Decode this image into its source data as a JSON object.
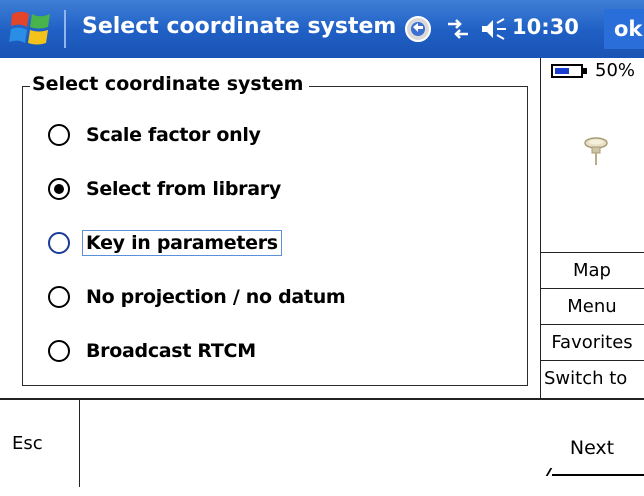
{
  "titlebar": {
    "title": "Select coordinate system",
    "clock": "10:30",
    "ok_label": "ok"
  },
  "group": {
    "legend": "Select coordinate system",
    "options": [
      {
        "label": "Scale factor only",
        "selected": false
      },
      {
        "label": "Select from library",
        "selected": true
      },
      {
        "label": "Key in parameters",
        "selected": false,
        "focused": true
      },
      {
        "label": "No projection / no datum",
        "selected": false
      },
      {
        "label": "Broadcast RTCM",
        "selected": false
      }
    ]
  },
  "status": {
    "battery": "50%"
  },
  "side_buttons": [
    "Map",
    "Menu",
    "Favorites",
    "Switch to"
  ],
  "bottombar": {
    "esc_label": "Esc",
    "next_label": "Next"
  },
  "colors": {
    "titlebar": "#1f5fc4",
    "accent": "#5a8fd9"
  }
}
